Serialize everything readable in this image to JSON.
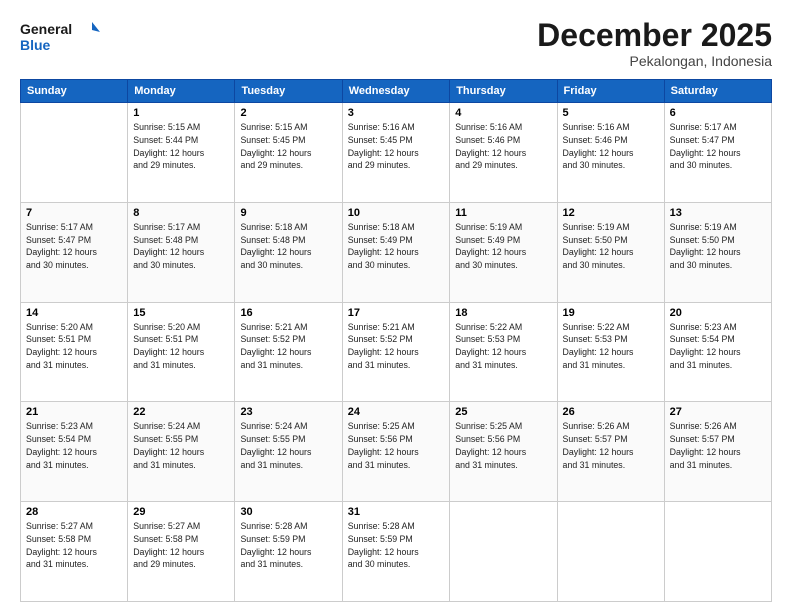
{
  "header": {
    "logo_line1": "General",
    "logo_line2": "Blue",
    "month": "December 2025",
    "location": "Pekalongan, Indonesia"
  },
  "days_of_week": [
    "Sunday",
    "Monday",
    "Tuesday",
    "Wednesday",
    "Thursday",
    "Friday",
    "Saturday"
  ],
  "weeks": [
    [
      {
        "day": "",
        "info": ""
      },
      {
        "day": "1",
        "info": "Sunrise: 5:15 AM\nSunset: 5:44 PM\nDaylight: 12 hours\nand 29 minutes."
      },
      {
        "day": "2",
        "info": "Sunrise: 5:15 AM\nSunset: 5:45 PM\nDaylight: 12 hours\nand 29 minutes."
      },
      {
        "day": "3",
        "info": "Sunrise: 5:16 AM\nSunset: 5:45 PM\nDaylight: 12 hours\nand 29 minutes."
      },
      {
        "day": "4",
        "info": "Sunrise: 5:16 AM\nSunset: 5:46 PM\nDaylight: 12 hours\nand 29 minutes."
      },
      {
        "day": "5",
        "info": "Sunrise: 5:16 AM\nSunset: 5:46 PM\nDaylight: 12 hours\nand 30 minutes."
      },
      {
        "day": "6",
        "info": "Sunrise: 5:17 AM\nSunset: 5:47 PM\nDaylight: 12 hours\nand 30 minutes."
      }
    ],
    [
      {
        "day": "7",
        "info": "Sunrise: 5:17 AM\nSunset: 5:47 PM\nDaylight: 12 hours\nand 30 minutes."
      },
      {
        "day": "8",
        "info": "Sunrise: 5:17 AM\nSunset: 5:48 PM\nDaylight: 12 hours\nand 30 minutes."
      },
      {
        "day": "9",
        "info": "Sunrise: 5:18 AM\nSunset: 5:48 PM\nDaylight: 12 hours\nand 30 minutes."
      },
      {
        "day": "10",
        "info": "Sunrise: 5:18 AM\nSunset: 5:49 PM\nDaylight: 12 hours\nand 30 minutes."
      },
      {
        "day": "11",
        "info": "Sunrise: 5:19 AM\nSunset: 5:49 PM\nDaylight: 12 hours\nand 30 minutes."
      },
      {
        "day": "12",
        "info": "Sunrise: 5:19 AM\nSunset: 5:50 PM\nDaylight: 12 hours\nand 30 minutes."
      },
      {
        "day": "13",
        "info": "Sunrise: 5:19 AM\nSunset: 5:50 PM\nDaylight: 12 hours\nand 30 minutes."
      }
    ],
    [
      {
        "day": "14",
        "info": "Sunrise: 5:20 AM\nSunset: 5:51 PM\nDaylight: 12 hours\nand 31 minutes."
      },
      {
        "day": "15",
        "info": "Sunrise: 5:20 AM\nSunset: 5:51 PM\nDaylight: 12 hours\nand 31 minutes."
      },
      {
        "day": "16",
        "info": "Sunrise: 5:21 AM\nSunset: 5:52 PM\nDaylight: 12 hours\nand 31 minutes."
      },
      {
        "day": "17",
        "info": "Sunrise: 5:21 AM\nSunset: 5:52 PM\nDaylight: 12 hours\nand 31 minutes."
      },
      {
        "day": "18",
        "info": "Sunrise: 5:22 AM\nSunset: 5:53 PM\nDaylight: 12 hours\nand 31 minutes."
      },
      {
        "day": "19",
        "info": "Sunrise: 5:22 AM\nSunset: 5:53 PM\nDaylight: 12 hours\nand 31 minutes."
      },
      {
        "day": "20",
        "info": "Sunrise: 5:23 AM\nSunset: 5:54 PM\nDaylight: 12 hours\nand 31 minutes."
      }
    ],
    [
      {
        "day": "21",
        "info": "Sunrise: 5:23 AM\nSunset: 5:54 PM\nDaylight: 12 hours\nand 31 minutes."
      },
      {
        "day": "22",
        "info": "Sunrise: 5:24 AM\nSunset: 5:55 PM\nDaylight: 12 hours\nand 31 minutes."
      },
      {
        "day": "23",
        "info": "Sunrise: 5:24 AM\nSunset: 5:55 PM\nDaylight: 12 hours\nand 31 minutes."
      },
      {
        "day": "24",
        "info": "Sunrise: 5:25 AM\nSunset: 5:56 PM\nDaylight: 12 hours\nand 31 minutes."
      },
      {
        "day": "25",
        "info": "Sunrise: 5:25 AM\nSunset: 5:56 PM\nDaylight: 12 hours\nand 31 minutes."
      },
      {
        "day": "26",
        "info": "Sunrise: 5:26 AM\nSunset: 5:57 PM\nDaylight: 12 hours\nand 31 minutes."
      },
      {
        "day": "27",
        "info": "Sunrise: 5:26 AM\nSunset: 5:57 PM\nDaylight: 12 hours\nand 31 minutes."
      }
    ],
    [
      {
        "day": "28",
        "info": "Sunrise: 5:27 AM\nSunset: 5:58 PM\nDaylight: 12 hours\nand 31 minutes."
      },
      {
        "day": "29",
        "info": "Sunrise: 5:27 AM\nSunset: 5:58 PM\nDaylight: 12 hours\nand 29 minutes."
      },
      {
        "day": "30",
        "info": "Sunrise: 5:28 AM\nSunset: 5:59 PM\nDaylight: 12 hours\nand 31 minutes."
      },
      {
        "day": "31",
        "info": "Sunrise: 5:28 AM\nSunset: 5:59 PM\nDaylight: 12 hours\nand 30 minutes."
      },
      {
        "day": "",
        "info": ""
      },
      {
        "day": "",
        "info": ""
      },
      {
        "day": "",
        "info": ""
      }
    ]
  ]
}
